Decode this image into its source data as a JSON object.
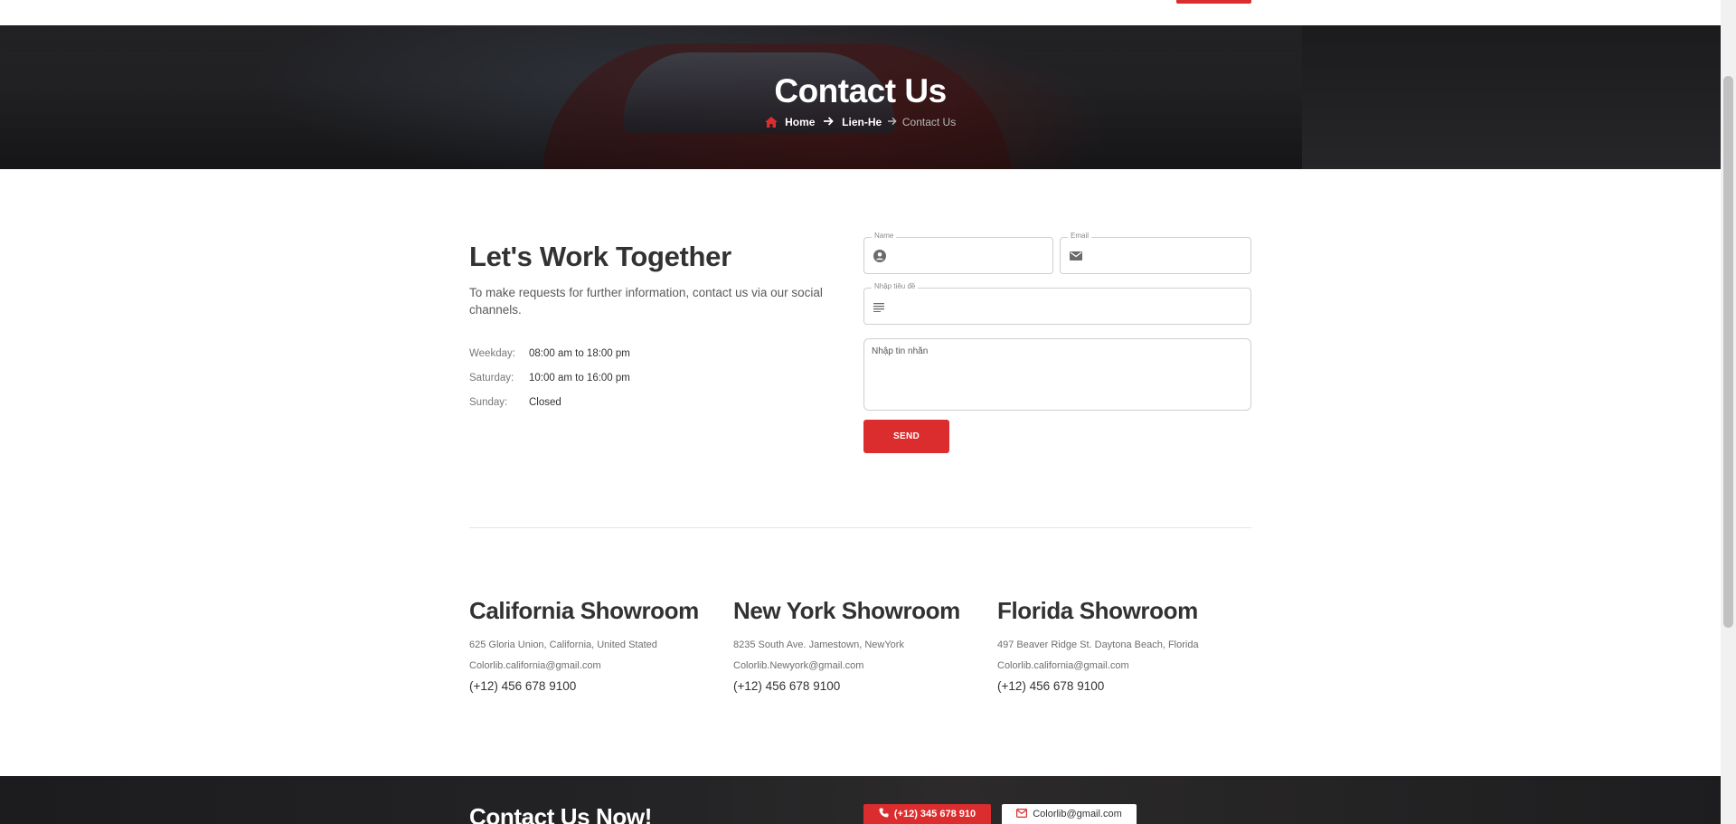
{
  "colors": {
    "accent": "#db2d2e",
    "text": "#323232",
    "muted": "#6f6f6f"
  },
  "hero": {
    "title": "Contact Us",
    "breadcrumb": {
      "home_icon": "home-icon",
      "home": "Home",
      "sep_icon": "arrow-right-icon",
      "parent": "Lien-He",
      "current": "Contact Us"
    }
  },
  "intro": {
    "title": "Let's Work Together",
    "description": "To make requests for further information, contact us via our social channels.",
    "hours": [
      {
        "day": "Weekday:",
        "time": "08:00 am to 18:00 pm"
      },
      {
        "day": "Saturday:",
        "time": "10:00 am to 16:00 pm"
      },
      {
        "day": "Sunday:",
        "time": "Closed"
      }
    ]
  },
  "form": {
    "name_label": "Name",
    "name_icon": "user-circle-icon",
    "email_label": "Email",
    "email_icon": "envelope-icon",
    "subject_label": "Nhập tiêu đề",
    "subject_icon": "lines-icon",
    "message_placeholder": "Nhập tin nhắn",
    "send_label": "SEND"
  },
  "showrooms": [
    {
      "title": "California Showroom",
      "address": "625 Gloria Union, California, United Stated",
      "email": "Colorlib.california@gmail.com",
      "phone": "(+12) 456 678 9100"
    },
    {
      "title": "New York Showroom",
      "address": "8235 South Ave. Jamestown, NewYork",
      "email": "Colorlib.Newyork@gmail.com",
      "phone": "(+12) 456 678 9100"
    },
    {
      "title": "Florida Showroom",
      "address": "497 Beaver Ridge St. Daytona Beach, Florida",
      "email": "Colorlib.california@gmail.com",
      "phone": "(+12) 456 678 9100"
    }
  ],
  "cta": {
    "title": "Contact Us Now!",
    "phone": "(+12) 345 678 910",
    "phone_icon": "phone-icon",
    "email": "Colorlib@gmail.com",
    "email_icon": "envelope-outline-icon"
  }
}
